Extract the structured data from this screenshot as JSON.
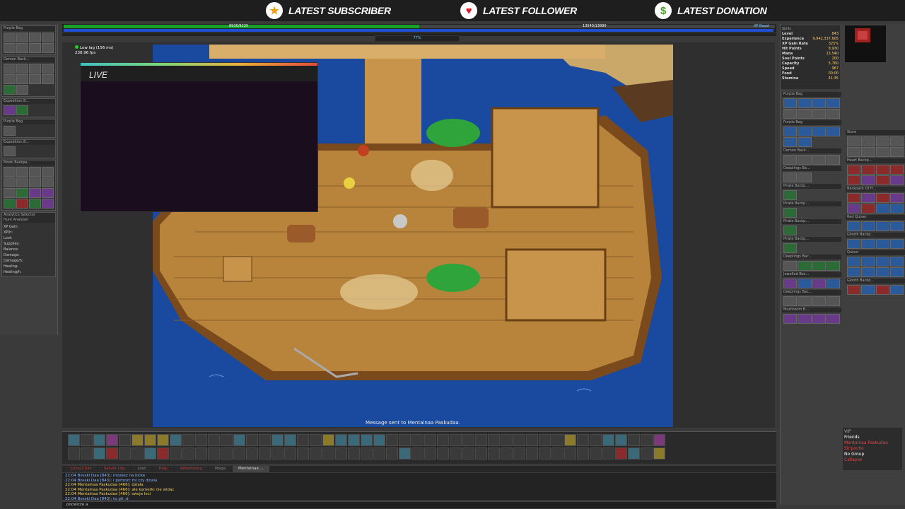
{
  "overlay": {
    "latest_subscriber": "LATEST SUBSCRIBER",
    "latest_follower": "LATEST FOLLOWER",
    "latest_donation": "LATEST DONATION",
    "live_label": "LIVE"
  },
  "status": {
    "hp_text": "8930/9235",
    "mana_text": "13540/13890",
    "exp_percent_text": "77%",
    "exp_fraction": 0.0,
    "lag_text": "Low lag (156 ms)",
    "fps_text": "238.96 fps",
    "xp_boost_label": "XP Boost"
  },
  "game": {
    "server_message": "Message sent to Mentalnaa Paskudaa."
  },
  "left_panel": {
    "sections": [
      "Purple Bag",
      "Demon Back...",
      "Expedition B...",
      "Purple Bag",
      "Expedition B...",
      "Moon Backpa..."
    ],
    "analytics_title": "Analytics Selector",
    "hunt_title": "Hunt Analyser",
    "hunt_rows": [
      "XP Gain:",
      "XP/h:",
      "Loot:",
      "Supplies:",
      "Balance:",
      "Damage:",
      "Damage/h:",
      "Healing:",
      "Healing/h:"
    ]
  },
  "chat": {
    "tabs": [
      "Local Chat",
      "Server Log",
      "Loot",
      "Help",
      "Advertising",
      "Mega",
      "Mentalnaa ..."
    ],
    "lines": [
      {
        "text": "22:04 Bosski Daa [843]: mozesz na kicke"
      },
      {
        "text": "22:04 Bosski Daa [843]: i pomozc mi czy dziala"
      },
      {
        "text": "22:04 Mentalnaa Paskudaa [466]: dziala"
      },
      {
        "text": "22:04 Mentalnaa Paskudaa [466]: ale kamerki nie widac"
      },
      {
        "text": "22:04 Mentalnaa Paskudaa [466]: swoja loci"
      },
      {
        "text": "22:04 Bosski Daa [843]: to git :d"
      }
    ],
    "input_value": "pocwicze a"
  },
  "skills": {
    "title": "Skills",
    "rows": [
      {
        "label": "Level",
        "value": "843"
      },
      {
        "label": "Experience",
        "value": "9,942,337,605"
      },
      {
        "label": "XP Gain Rate",
        "value": "325%"
      },
      {
        "label": "Hit Points",
        "value": "8,930"
      },
      {
        "label": "Mana",
        "value": "13,540"
      },
      {
        "label": "Soul Points",
        "value": "200"
      },
      {
        "label": "Capacity",
        "value": "5,760"
      },
      {
        "label": "Speed",
        "value": "967"
      },
      {
        "label": "Food",
        "value": "00:00"
      },
      {
        "label": "Stamina",
        "value": "41:35"
      }
    ]
  },
  "right_panel": {
    "col1_sections": [
      "Purple Bag",
      "Purple Bag",
      "Demon Back...",
      "Deeplings Ba...",
      "Pirate Backp...",
      "Pirate Backp...",
      "Pirate Backp...",
      "Pirate Backp...",
      "Deeplings Bac...",
      "Jewelled Bac...",
      "Deeplings Bac...",
      "Mushroom B..."
    ],
    "col2_sections": [
      "Store",
      "Heart Backp...",
      "Backpack Of H...",
      "Red Quiver",
      "Glooth Backp...",
      "Quiver",
      "Glooth Backp..."
    ],
    "vip_title": "VIP",
    "vip_friends": "Friends",
    "vip_entries": [
      "Mentalnaa Paskudaa",
      "Sir'pocho"
    ],
    "vip_group": "No Group",
    "vip_group_entries": [
      "Callayox"
    ]
  },
  "colors": {
    "hp": "#18a028",
    "mana": "#1f4fd0",
    "ocean": "#1a4aa0",
    "deck": "#b8843c"
  }
}
